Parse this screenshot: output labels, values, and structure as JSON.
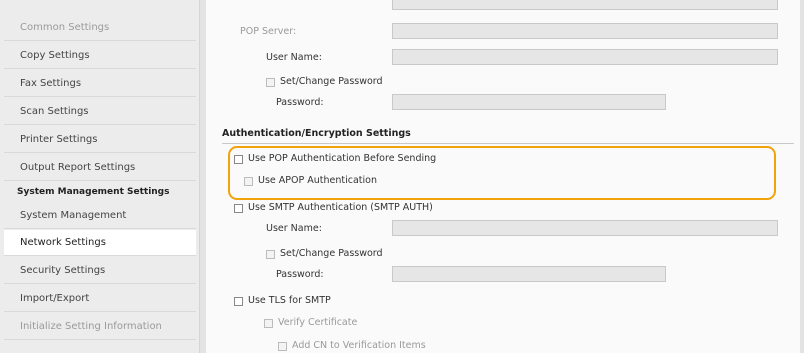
{
  "sidebar": {
    "items": [
      {
        "label": "Common Settings",
        "state": "dim"
      },
      {
        "label": "Copy Settings",
        "state": "normal"
      },
      {
        "label": "Fax Settings",
        "state": "normal"
      },
      {
        "label": "Scan Settings",
        "state": "normal"
      },
      {
        "label": "Printer Settings",
        "state": "normal"
      },
      {
        "label": "Output Report Settings",
        "state": "normal"
      }
    ],
    "heading": "System Management Settings",
    "subitems": [
      {
        "label": "System Management",
        "state": "normal"
      },
      {
        "label": "Network Settings",
        "state": "current"
      },
      {
        "label": "Security Settings",
        "state": "normal"
      },
      {
        "label": "Import/Export",
        "state": "normal"
      },
      {
        "label": "Initialize Setting Information",
        "state": "dim"
      }
    ]
  },
  "pop": {
    "server_label": "POP Server:",
    "user_name_label": "User Name:",
    "set_change_password_label": "Set/Change Password",
    "password_label": "Password:"
  },
  "auth": {
    "section_title": "Authentication/Encryption Settings",
    "pop_before_sending_label": "Use POP Authentication Before Sending",
    "apop_label": "Use APOP Authentication",
    "smtp_auth_label": "Use SMTP Authentication (SMTP AUTH)",
    "user_name_label": "User Name:",
    "set_change_password_label": "Set/Change Password",
    "password_label": "Password:",
    "tls_label": "Use TLS for SMTP",
    "verify_certificate_label": "Verify Certificate",
    "add_cn_label": "Add CN to Verification Items"
  },
  "colors": {
    "highlight": "#f0a30a",
    "sidebar_bg": "#ececec",
    "selected_bg": "#ffffff"
  }
}
